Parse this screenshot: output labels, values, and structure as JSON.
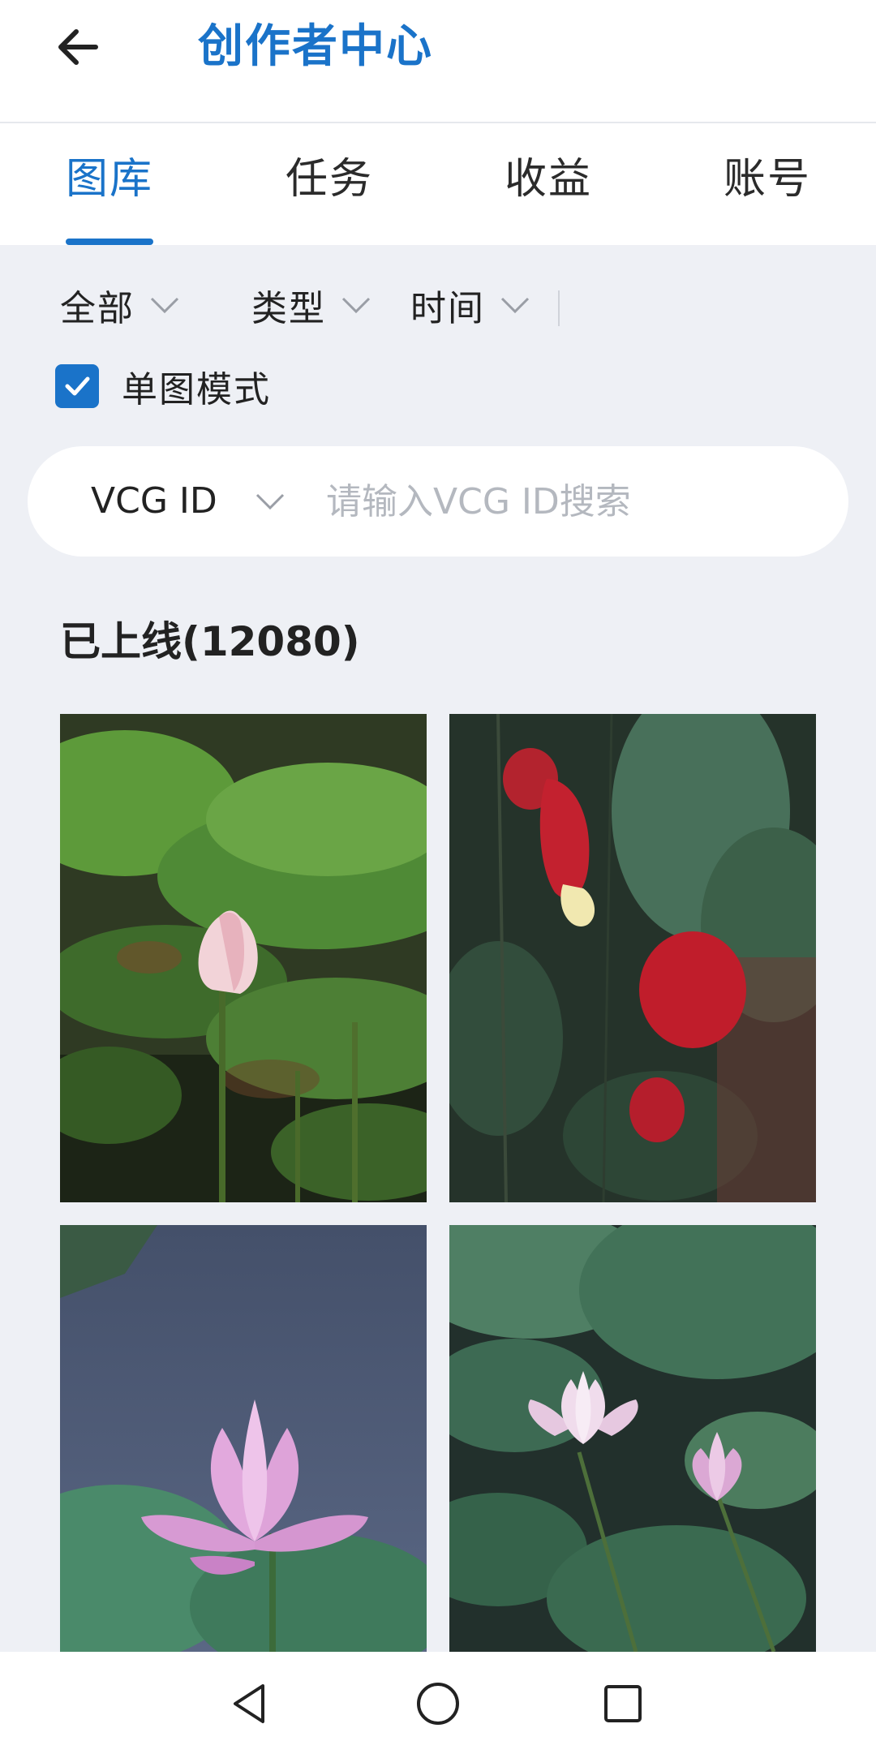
{
  "header": {
    "back_icon": "arrow-left-icon",
    "title": "创作者中心",
    "title_color": "#1a73c9"
  },
  "tabs": [
    {
      "label": "图库",
      "active": true
    },
    {
      "label": "任务",
      "active": false
    },
    {
      "label": "收益",
      "active": false
    },
    {
      "label": "账号",
      "active": false
    }
  ],
  "filters": [
    {
      "label": "全部",
      "icon": "chevron-down-icon"
    },
    {
      "label": "类型",
      "icon": "chevron-down-icon"
    },
    {
      "label": "时间",
      "icon": "chevron-down-icon"
    }
  ],
  "single_mode": {
    "label": "单图模式",
    "checked": true
  },
  "search": {
    "type_label": "VCG ID",
    "value": "",
    "placeholder": "请输入VCG ID搜索"
  },
  "gallery": {
    "section_title": "已上线(12080)",
    "photos": [
      {
        "subject": "pink lotus bud among green lotus leaves"
      },
      {
        "subject": "red hanging lantern flowers with leaves"
      },
      {
        "subject": "pink lotus flower against blue water"
      },
      {
        "subject": "two pink water lilies among lily pads"
      }
    ]
  },
  "navbar": {
    "back": "triangle-back-icon",
    "home": "circle-home-icon",
    "recents": "square-recents-icon"
  },
  "colors": {
    "accent": "#1a73c9",
    "background": "#eef0f5",
    "surface": "#ffffff"
  }
}
